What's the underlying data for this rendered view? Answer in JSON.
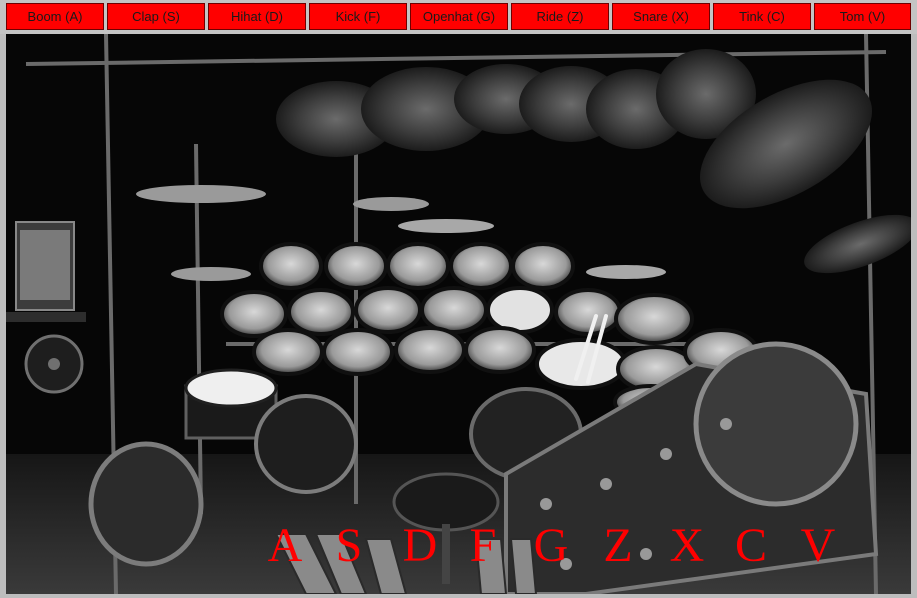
{
  "buttons": [
    {
      "label": "Boom (A)"
    },
    {
      "label": "Clap (S)"
    },
    {
      "label": "Hihat (D)"
    },
    {
      "label": "Kick (F)"
    },
    {
      "label": "Openhat (G)"
    },
    {
      "label": "Ride (Z)"
    },
    {
      "label": "Snare (X)"
    },
    {
      "label": "Tink (C)"
    },
    {
      "label": "Tom (V)"
    }
  ],
  "keys": [
    "A",
    "S",
    "D",
    "F",
    "G",
    "Z",
    "X",
    "C",
    "V"
  ],
  "colors": {
    "button_bg": "#ff0000",
    "key_letter": "#ff0000",
    "page_bg": "#bdbdbd"
  }
}
